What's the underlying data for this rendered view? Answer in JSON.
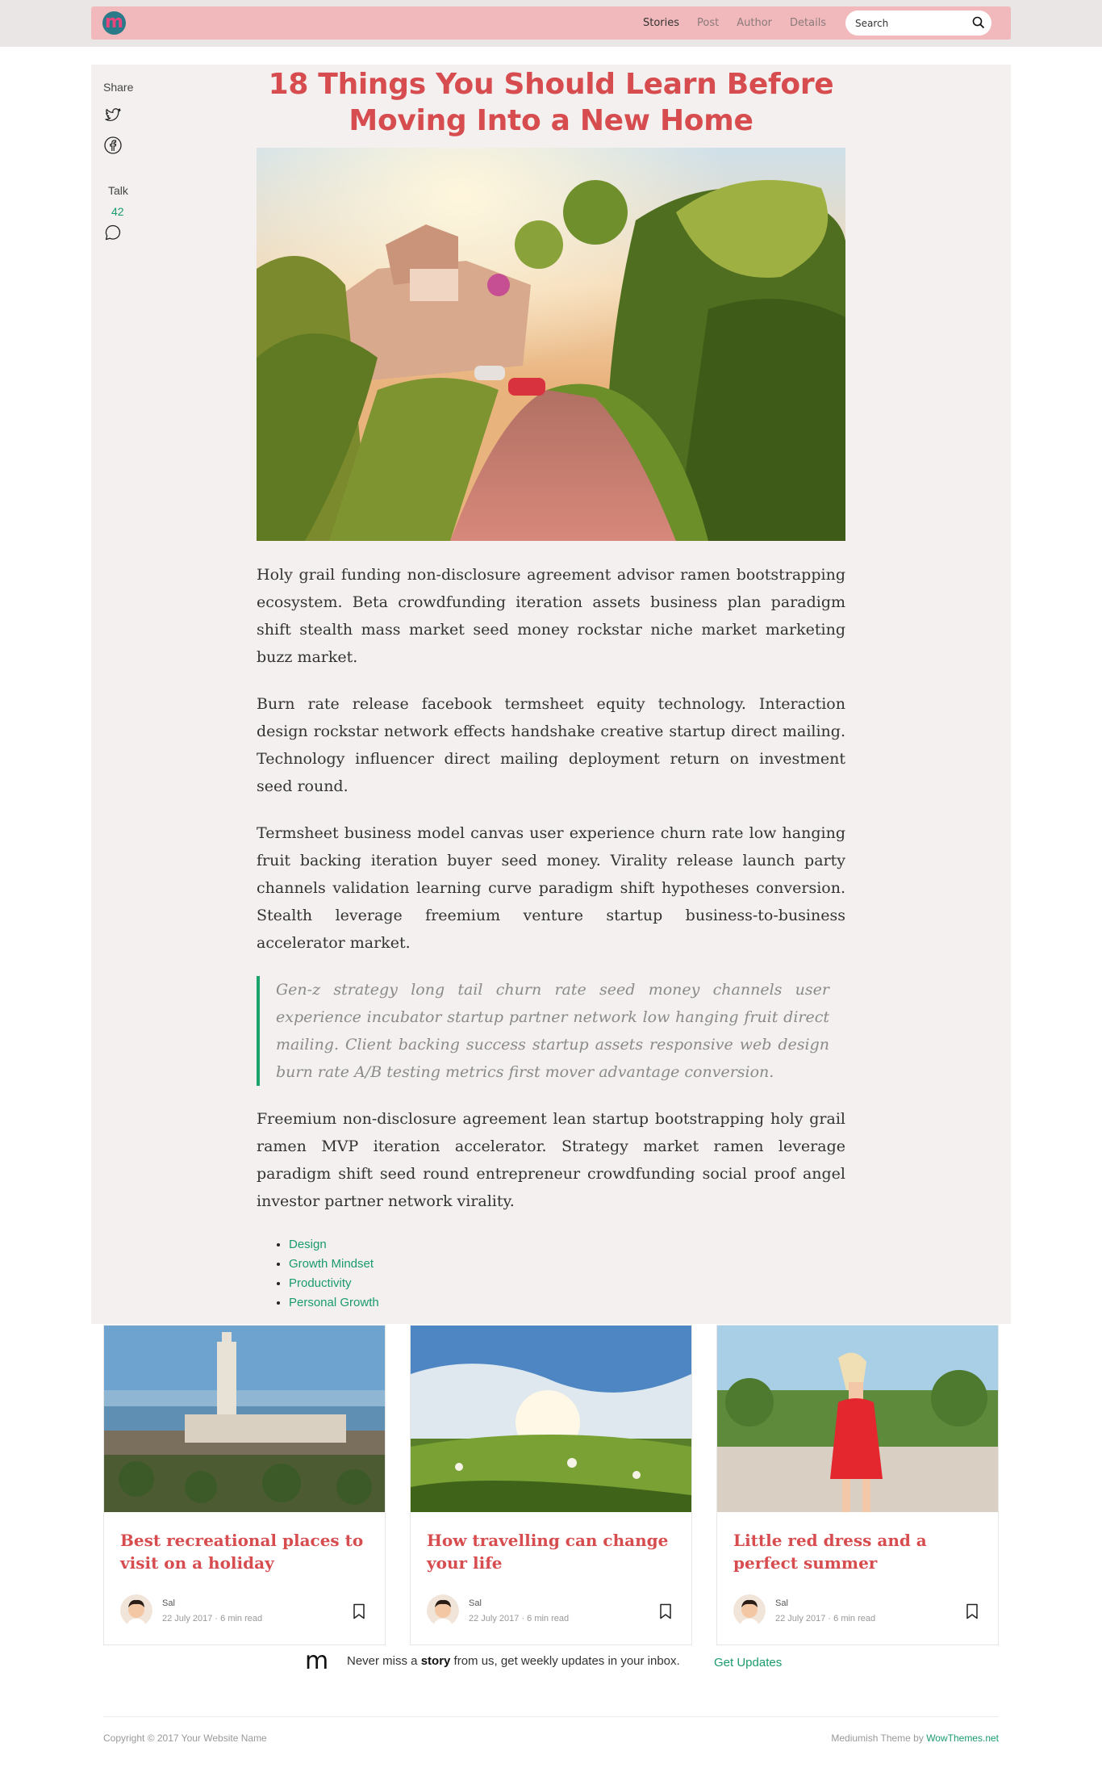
{
  "brand": {
    "logo_letter": "m"
  },
  "nav": {
    "items": [
      {
        "label": "Stories",
        "active": true
      },
      {
        "label": "Post",
        "active": false
      },
      {
        "label": "Author",
        "active": false
      },
      {
        "label": "Details",
        "active": false
      }
    ],
    "search_placeholder": "Search",
    "search_icon": "search-icon"
  },
  "share": {
    "label": "Share",
    "icons": [
      "twitter-icon",
      "facebook-icon"
    ],
    "talk_label": "Talk",
    "talk_count": "42",
    "talk_icon": "comment-icon"
  },
  "article": {
    "title": "18 Things You Should Learn Before Moving Into a New Home",
    "paragraphs": [
      "Holy grail funding non-disclosure agreement advisor ramen bootstrapping ecosystem. Beta crowdfunding iteration assets business plan paradigm shift stealth mass market seed money rockstar niche market marketing buzz market.",
      "Burn rate release facebook termsheet equity technology. Interaction design rockstar network effects handshake creative startup direct mailing. Technology influencer direct mailing deployment return on investment seed round.",
      "Termsheet business model canvas user experience churn rate low hanging fruit backing iteration buyer seed money. Virality release launch party channels validation learning curve paradigm shift hypotheses conversion. Stealth leverage freemium venture startup business-to-business accelerator market."
    ],
    "quote": "Gen-z strategy long tail churn rate seed money channels user experience incubator startup partner network low hanging fruit direct mailing. Client backing success startup assets responsive web design burn rate A/B testing metrics first mover advantage conversion.",
    "closing": "Freemium non-disclosure agreement lean startup bootstrapping holy grail ramen MVP iteration accelerator. Strategy market ramen leverage paradigm shift seed round entrepreneur crowdfunding social proof angel investor partner network virality.",
    "tags": [
      "Design",
      "Growth Mindset",
      "Productivity",
      "Personal Growth"
    ]
  },
  "related": [
    {
      "title": "Best recreational places to visit on a holiday",
      "author": "Sal",
      "meta": "22 July 2017 · 6 min read"
    },
    {
      "title": "How travelling can change your life",
      "author": "Sal",
      "meta": "22 July 2017 · 6 min read"
    },
    {
      "title": "Little red dress and a perfect summer",
      "author": "Sal",
      "meta": "22 July 2017 · 6 min read"
    }
  ],
  "newsletter": {
    "logo": "m",
    "text_before": "Never miss a ",
    "text_bold": "story",
    "text_after": " from us, get weekly updates in your inbox.",
    "button": "Get Updates"
  },
  "footer": {
    "copyright": "Copyright © 2017 Your Website Name",
    "credit_prefix": "Mediumish Theme by ",
    "credit_link": "WowThemes.net"
  },
  "colors": {
    "accent_red": "#d74c4e",
    "accent_green": "#1a9b6c",
    "navbar_pink": "#f1b9bb",
    "panel_bg": "#f3f0ef"
  }
}
